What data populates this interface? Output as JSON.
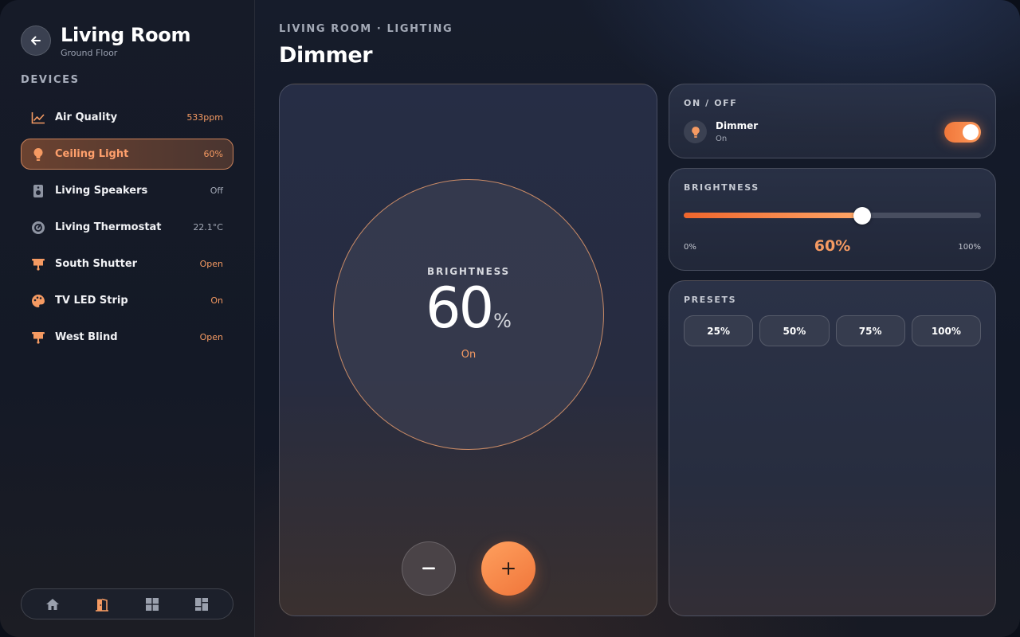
{
  "room": {
    "title": "Living Room",
    "subtitle": "Ground Floor",
    "back_icon": "arrow-left-icon"
  },
  "sidebar": {
    "section_label": "DEVICES",
    "devices": [
      {
        "name": "Air Quality",
        "status": "533ppm",
        "icon": "chart-line-icon",
        "active": false,
        "status_accent": true
      },
      {
        "name": "Ceiling Light",
        "status": "60%",
        "icon": "lightbulb-icon",
        "active": true,
        "status_accent": true
      },
      {
        "name": "Living Speakers",
        "status": "Off",
        "icon": "speaker-icon",
        "active": false,
        "status_accent": false
      },
      {
        "name": "Living Thermostat",
        "status": "22.1°C",
        "icon": "thermostat-icon",
        "active": false,
        "status_accent": false
      },
      {
        "name": "South Shutter",
        "status": "Open",
        "icon": "shutter-icon",
        "active": false,
        "status_accent": true
      },
      {
        "name": "TV LED Strip",
        "status": "On",
        "icon": "palette-icon",
        "active": false,
        "status_accent": true
      },
      {
        "name": "West Blind",
        "status": "Open",
        "icon": "blind-icon",
        "active": false,
        "status_accent": true
      }
    ],
    "bottom_nav": [
      {
        "icon": "home-icon",
        "active": false
      },
      {
        "icon": "door-icon",
        "active": true
      },
      {
        "icon": "grid-icon",
        "active": false
      },
      {
        "icon": "dashboard-icon",
        "active": false
      }
    ]
  },
  "header": {
    "breadcrumb": "LIVING ROOM · LIGHTING",
    "title": "Dimmer"
  },
  "dial": {
    "label": "BRIGHTNESS",
    "value": "60",
    "unit": "%",
    "status": "On",
    "decrease_icon": "minus-icon",
    "increase_icon": "plus-icon"
  },
  "power": {
    "label": "ON / OFF",
    "device_name": "Dimmer",
    "device_state": "On",
    "toggle_on": true
  },
  "brightness": {
    "label": "BRIGHTNESS",
    "value_fraction": 0.6,
    "min_label": "0%",
    "max_label": "100%",
    "value_label": "60%"
  },
  "presets": {
    "label": "PRESETS",
    "options": [
      "25%",
      "50%",
      "75%",
      "100%"
    ]
  },
  "colors": {
    "accent": "#f59a62",
    "accent_strong": "#f0753a",
    "background": "#121826",
    "card": "#2c344a"
  }
}
